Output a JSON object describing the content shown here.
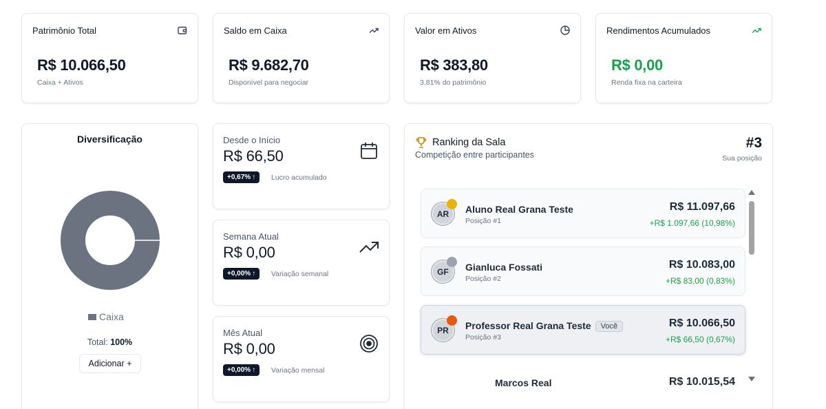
{
  "stats": [
    {
      "label": "Patrimônio Total",
      "value": "R$ 10.066,50",
      "sub": "Caixa + Ativos",
      "icon": "wallet-icon"
    },
    {
      "label": "Saldo em Caixa",
      "value": "R$ 9.682,70",
      "sub": "Disponível para negociar",
      "icon": "trending-up-icon"
    },
    {
      "label": "Valor em Ativos",
      "value": "R$ 383,80",
      "sub": "3,81% do patrimônio",
      "icon": "pie-chart-icon"
    },
    {
      "label": "Rendimentos Acumulados",
      "value": "R$ 0,00",
      "sub": "Renda fixa na carteira",
      "icon": "trending-up-green-icon"
    }
  ],
  "diversification": {
    "title": "Diversificação",
    "legend": "Caixa",
    "total_label": "Total:",
    "total_value": "100%",
    "add_label": "Adicionar +",
    "slices": [
      {
        "name": "Caixa",
        "share": 1.0,
        "color": "#6b7280"
      }
    ]
  },
  "periods": [
    {
      "label": "Desde o Início",
      "value": "R$ 66,50",
      "badge": "+0,67%",
      "note": "Lucro acumulado",
      "icon": "calendar-icon"
    },
    {
      "label": "Semana Atual",
      "value": "R$ 0,00",
      "badge": "+0,00%",
      "note": "Variação semanal",
      "icon": "trending-up-icon"
    },
    {
      "label": "Mês Atual",
      "value": "R$ 0,00",
      "badge": "+0,00%",
      "note": "Variação mensal",
      "icon": "target-icon"
    }
  ],
  "ranking": {
    "title": "Ranking da Sala",
    "subtitle": "Competição entre participantes",
    "position": "#3",
    "position_label": "Sua posição",
    "you_label": "Você",
    "rows": [
      {
        "initials": "AR",
        "name": "Aluno Real Grana Teste",
        "pos": "Posição #1",
        "value": "R$ 11.097,66",
        "gain": "+R$ 1.097,66 (10,98%)",
        "medal": "#eab308"
      },
      {
        "initials": "GF",
        "name": "Gianluca Fossati",
        "pos": "Posição #2",
        "value": "R$ 10.083,00",
        "gain": "+R$ 83,00 (0,83%)",
        "medal": "#9ca3af"
      },
      {
        "initials": "PR",
        "name": "Professor Real Grana Teste",
        "pos": "Posição #3",
        "value": "R$ 10.066,50",
        "gain": "+R$ 66,50 (0,67%)",
        "medal": "#ea580c"
      },
      {
        "initials": "",
        "name": "Marcos Real",
        "pos": "",
        "value": "R$ 10.015,54",
        "gain": ""
      }
    ]
  },
  "colors": {
    "accent_green": "#16a34a",
    "dark": "#0f172a",
    "muted": "#6b7280"
  }
}
